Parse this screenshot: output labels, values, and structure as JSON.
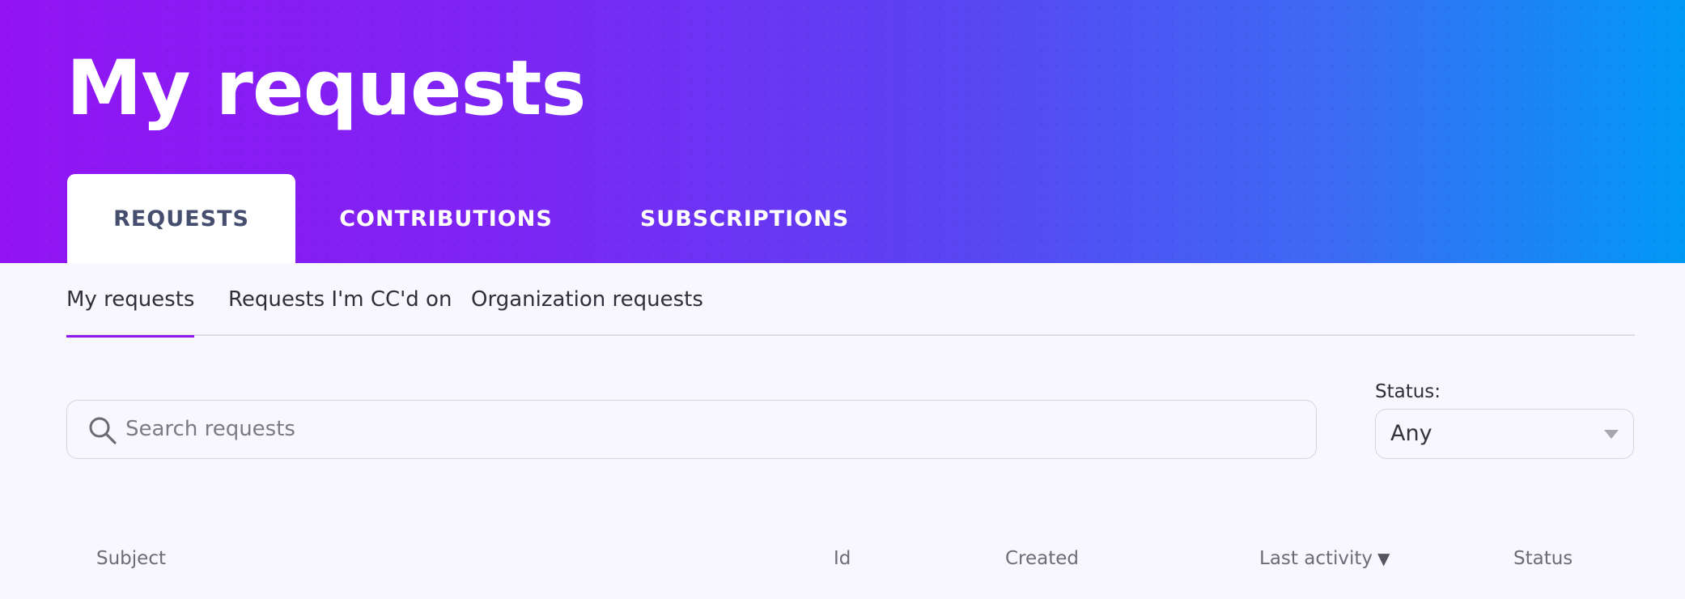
{
  "header": {
    "title": "My requests"
  },
  "top_tabs": [
    {
      "label": "REQUESTS",
      "active": true
    },
    {
      "label": "CONTRIBUTIONS",
      "active": false
    },
    {
      "label": "SUBSCRIPTIONS",
      "active": false
    }
  ],
  "sub_nav": [
    {
      "label": "My requests",
      "active": true
    },
    {
      "label": "Requests I'm CC'd on",
      "active": false
    },
    {
      "label": "Organization requests",
      "active": false
    }
  ],
  "search": {
    "placeholder": "Search requests",
    "value": "",
    "icon": "search-icon"
  },
  "status_filter": {
    "label": "Status:",
    "selected": "Any",
    "icon": "chevron-down-icon"
  },
  "table": {
    "columns": [
      {
        "label": "Subject"
      },
      {
        "label": "Id"
      },
      {
        "label": "Created"
      },
      {
        "label": "Last activity",
        "sort_indicator": "▼"
      },
      {
        "label": "Status"
      }
    ]
  },
  "colors": {
    "gradient_start": "#9214f4",
    "gradient_end": "#0199f6",
    "active_underline": "#8f17ea",
    "active_tab_text": "#454e6e"
  }
}
